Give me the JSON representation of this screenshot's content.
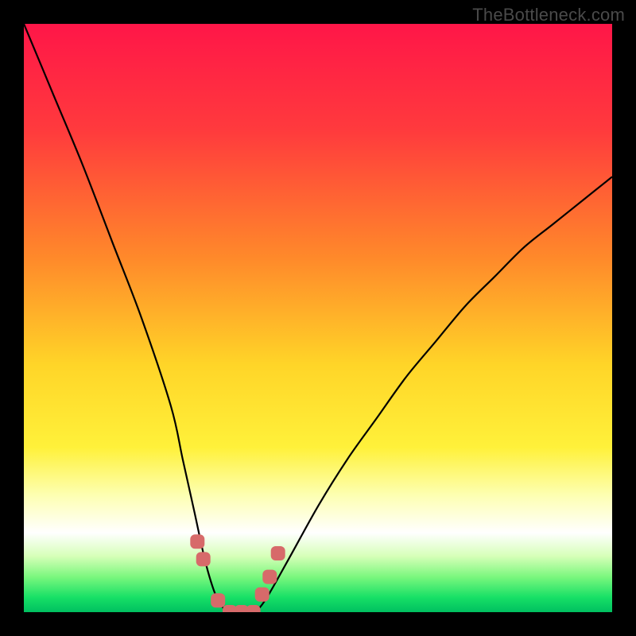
{
  "watermark": "TheBottleneck.com",
  "chart_data": {
    "type": "line",
    "title": "",
    "xlabel": "",
    "ylabel": "",
    "xlim": [
      0,
      100
    ],
    "ylim": [
      0,
      100
    ],
    "series": [
      {
        "name": "bottleneck-curve",
        "x": [
          0,
          5,
          10,
          15,
          20,
          25,
          27,
          29,
          31,
          33,
          35,
          37,
          39,
          41,
          45,
          50,
          55,
          60,
          65,
          70,
          75,
          80,
          85,
          90,
          95,
          100
        ],
        "values": [
          100,
          88,
          76,
          63,
          50,
          35,
          26,
          17,
          8,
          2,
          0,
          0,
          0,
          2,
          9,
          18,
          26,
          33,
          40,
          46,
          52,
          57,
          62,
          66,
          70,
          74
        ]
      }
    ],
    "markers": {
      "name": "highlight-points",
      "color": "#d76a6a",
      "x": [
        29.5,
        30.5,
        33,
        35,
        37,
        39,
        40.5,
        41.8,
        43.2
      ],
      "values": [
        12,
        9,
        2,
        0,
        0,
        0,
        3,
        6,
        10
      ]
    },
    "background_gradient": {
      "stops": [
        {
          "offset": 0.0,
          "color": "#ff1648"
        },
        {
          "offset": 0.18,
          "color": "#ff3a3d"
        },
        {
          "offset": 0.4,
          "color": "#ff8a2a"
        },
        {
          "offset": 0.58,
          "color": "#ffd528"
        },
        {
          "offset": 0.72,
          "color": "#fff13a"
        },
        {
          "offset": 0.8,
          "color": "#fdffb0"
        },
        {
          "offset": 0.865,
          "color": "#ffffff"
        },
        {
          "offset": 0.905,
          "color": "#d6ffb8"
        },
        {
          "offset": 0.94,
          "color": "#7bf77e"
        },
        {
          "offset": 0.975,
          "color": "#17e066"
        },
        {
          "offset": 1.0,
          "color": "#00c060"
        }
      ]
    }
  }
}
